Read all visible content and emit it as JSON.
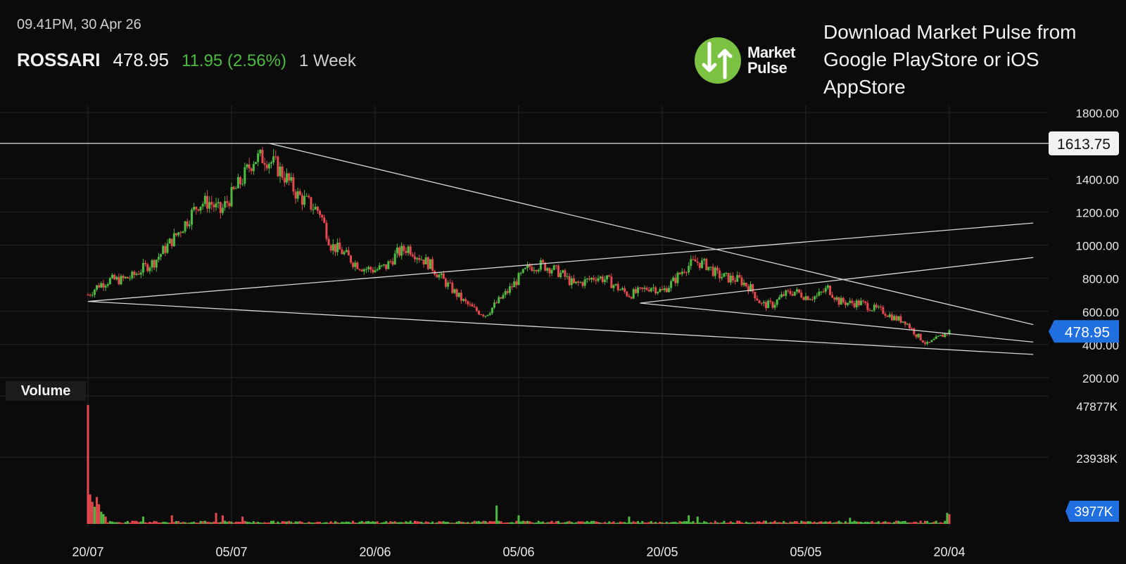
{
  "header": {
    "timestamp": "09.41PM, 30 Apr 26",
    "symbol": "ROSSARI",
    "price": "478.95",
    "change": "11.95 (2.56%)",
    "range": "1 Week"
  },
  "brand": {
    "name_line1": "Market",
    "name_line2": "Pulse",
    "promo": "Download Market Pulse from Google PlayStore or iOS AppStore"
  },
  "colors": {
    "up": "#4cbb3f",
    "down": "#e5484d",
    "accent": "#1f6fe0",
    "grid": "#262626",
    "background": "#0b0b0b"
  },
  "chart_data": [
    {
      "type": "candlestick",
      "title": "",
      "ylim": [
        100,
        1850
      ],
      "y_ticks": [
        "1800.00",
        "1400.00",
        "1200.00",
        "1000.00",
        "800.00",
        "600.00",
        "400.00",
        "200.00"
      ],
      "x_ticks": [
        "20/07",
        "05/07",
        "20/06",
        "05/06",
        "20/05",
        "05/05",
        "20/04"
      ],
      "horizontal_level": {
        "value": 1613.75,
        "label": "1613.75"
      },
      "last_price": {
        "value": 478.95,
        "label": "478.95"
      },
      "approx_close_path": [
        [
          0,
          700
        ],
        [
          5,
          760
        ],
        [
          10,
          790
        ],
        [
          15,
          790
        ],
        [
          20,
          810
        ],
        [
          25,
          860
        ],
        [
          30,
          900
        ],
        [
          35,
          980
        ],
        [
          40,
          1060
        ],
        [
          45,
          1150
        ],
        [
          50,
          1250
        ],
        [
          55,
          1260
        ],
        [
          60,
          1200
        ],
        [
          65,
          1300
        ],
        [
          70,
          1400
        ],
        [
          75,
          1520
        ],
        [
          80,
          1530
        ],
        [
          85,
          1480
        ],
        [
          90,
          1400
        ],
        [
          95,
          1300
        ],
        [
          100,
          1250
        ],
        [
          105,
          1200
        ],
        [
          110,
          1000
        ],
        [
          115,
          960
        ],
        [
          120,
          900
        ],
        [
          125,
          860
        ],
        [
          130,
          850
        ],
        [
          135,
          870
        ],
        [
          140,
          950
        ],
        [
          145,
          985
        ],
        [
          150,
          930
        ],
        [
          155,
          880
        ],
        [
          160,
          800
        ],
        [
          165,
          730
        ],
        [
          170,
          660
        ],
        [
          175,
          610
        ],
        [
          180,
          580
        ],
        [
          185,
          650
        ],
        [
          190,
          720
        ],
        [
          195,
          800
        ],
        [
          200,
          870
        ],
        [
          205,
          880
        ],
        [
          210,
          860
        ],
        [
          215,
          820
        ],
        [
          220,
          760
        ],
        [
          225,
          780
        ],
        [
          230,
          810
        ],
        [
          235,
          790
        ],
        [
          240,
          740
        ],
        [
          245,
          700
        ],
        [
          250,
          720
        ],
        [
          255,
          750
        ],
        [
          260,
          720
        ],
        [
          265,
          780
        ],
        [
          270,
          860
        ],
        [
          275,
          900
        ],
        [
          280,
          880
        ],
        [
          285,
          820
        ],
        [
          290,
          800
        ],
        [
          295,
          790
        ],
        [
          300,
          740
        ],
        [
          305,
          640
        ],
        [
          310,
          640
        ],
        [
          315,
          700
        ],
        [
          320,
          720
        ],
        [
          325,
          690
        ],
        [
          330,
          690
        ],
        [
          335,
          740
        ],
        [
          340,
          660
        ],
        [
          345,
          650
        ],
        [
          350,
          650
        ],
        [
          355,
          620
        ],
        [
          360,
          600
        ],
        [
          365,
          560
        ],
        [
          370,
          540
        ],
        [
          375,
          460
        ],
        [
          380,
          400
        ],
        [
          385,
          440
        ],
        [
          390,
          478.95
        ]
      ],
      "trendlines": [
        {
          "from": [
            0,
            660
          ],
          "to": [
            428,
            1133
          ]
        },
        {
          "from": [
            0,
            660
          ],
          "to": [
            428,
            340
          ]
        },
        {
          "from": [
            82,
            1613.75
          ],
          "to": [
            428,
            520
          ]
        },
        {
          "from": [
            250,
            650
          ],
          "to": [
            428,
            925
          ]
        },
        {
          "from": [
            250,
            650
          ],
          "to": [
            428,
            415
          ]
        }
      ],
      "x_tick_positions": [
        0,
        65,
        130,
        195,
        260,
        325,
        390
      ]
    },
    {
      "type": "bar",
      "title": "Volume",
      "y_ticks": [
        "47877K",
        "23938K"
      ],
      "ylim": [
        0,
        47877
      ],
      "last_volume": {
        "value": 3977,
        "label": "3977K"
      },
      "approx_values_k": [
        [
          0,
          48500
        ],
        [
          1,
          12000
        ],
        [
          2,
          9000
        ],
        [
          3,
          7000
        ],
        [
          4,
          11000
        ],
        [
          5,
          8000
        ],
        [
          6,
          5000
        ],
        [
          7,
          4000
        ],
        [
          8,
          3000
        ],
        [
          25,
          3000
        ],
        [
          38,
          3500
        ],
        [
          58,
          4500
        ],
        [
          61,
          3500
        ],
        [
          70,
          3000
        ],
        [
          185,
          7500
        ],
        [
          195,
          3500
        ],
        [
          245,
          3000
        ],
        [
          272,
          3500
        ],
        [
          276,
          3000
        ],
        [
          345,
          2500
        ],
        [
          389,
          4500
        ],
        [
          390,
          3977
        ]
      ]
    }
  ]
}
